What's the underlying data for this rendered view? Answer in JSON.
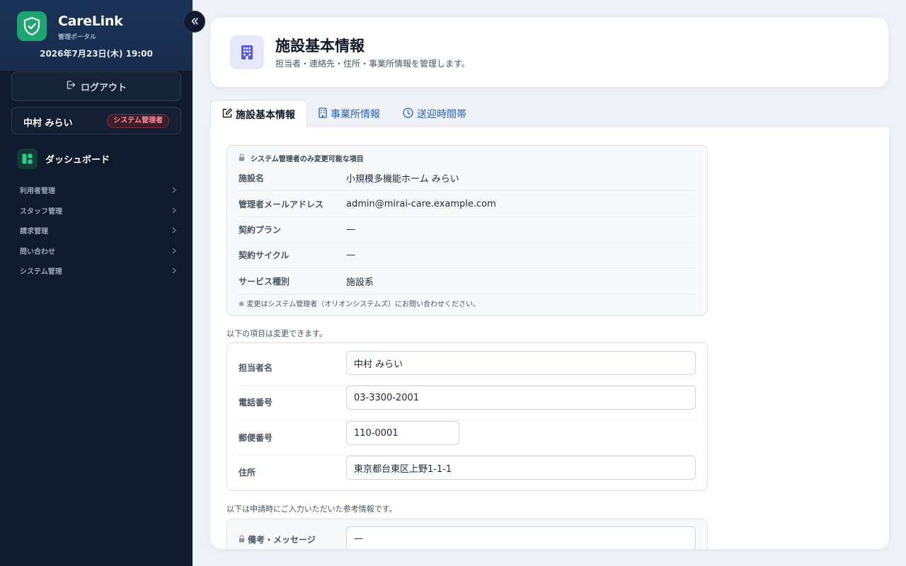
{
  "sidebar": {
    "brand": "CareLink",
    "brand_sub": "管理ポータル",
    "datetime": "2026年7月23日(木) 19:00",
    "logout_label": "ログアウト",
    "user_name": "中村 みらい",
    "user_role": "システム管理者",
    "dashboard_label": "ダッシュボード",
    "nav_items": [
      {
        "label": "利用者管理"
      },
      {
        "label": "スタッフ管理"
      },
      {
        "label": "請求管理"
      },
      {
        "label": "問い合わせ"
      },
      {
        "label": "システム管理"
      }
    ],
    "colors": {
      "accent": "#1ea672",
      "background": "#0f1a2e"
    }
  },
  "header": {
    "title": "施設基本情報",
    "subtitle": "担当者・連絡先・住所・事業所情報を管理します。"
  },
  "tabs": [
    {
      "label": "施設基本情報",
      "icon": "edit-icon",
      "active": true
    },
    {
      "label": "事業所情報",
      "icon": "building-icon",
      "active": false
    },
    {
      "label": "送迎時間帯",
      "icon": "clock-icon",
      "active": false
    }
  ],
  "readonly": {
    "heading": "システム管理者のみ変更可能な項目",
    "rows": [
      {
        "label": "施設名",
        "value": "小規模多機能ホーム みらい"
      },
      {
        "label": "管理者メールアドレス",
        "value": "admin@mirai-care.example.com"
      },
      {
        "label": "契約プラン",
        "value": "—"
      },
      {
        "label": "契約サイクル",
        "value": "—"
      },
      {
        "label": "サービス種別",
        "value": "施設系"
      }
    ],
    "note": "※ 変更はシステム管理者（オリオンシステムズ）にお問い合わせください。"
  },
  "editable": {
    "note": "以下の項目は変更できます。",
    "rows": [
      {
        "label": "担当者名",
        "value": "中村 みらい"
      },
      {
        "label": "電話番号",
        "value": "03-3300-2001"
      },
      {
        "label": "郵便番号",
        "value": "110-0001"
      },
      {
        "label": "住所",
        "value": "東京都台東区上野1-1-1"
      }
    ]
  },
  "reference": {
    "note": "以下は申請時にご入力いただいた参考情報です。",
    "label": "備考・メッセージ",
    "value": "—"
  }
}
